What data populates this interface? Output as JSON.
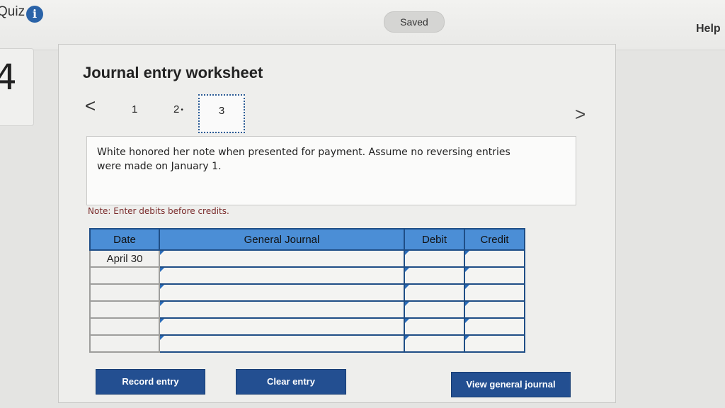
{
  "header": {
    "quiz_label": "Quiz",
    "info_icon": "i",
    "saved_label": "Saved",
    "help_label": "Help"
  },
  "sidebar": {
    "question_number": "4"
  },
  "worksheet": {
    "title": "Journal entry worksheet",
    "nav_prev": "<",
    "nav_next": ">",
    "tabs": [
      {
        "label": "1"
      },
      {
        "label": "2",
        "marker": "•"
      },
      {
        "label": "3",
        "active": true
      }
    ],
    "prompt": "White honored her note when presented for payment. Assume no reversing entries were made on January 1.",
    "note": "Note: Enter debits before credits."
  },
  "journal": {
    "headers": [
      "Date",
      "General Journal",
      "Debit",
      "Credit"
    ],
    "rows": [
      {
        "date": "April 30",
        "account": "",
        "debit": "",
        "credit": ""
      },
      {
        "date": "",
        "account": "",
        "debit": "",
        "credit": ""
      },
      {
        "date": "",
        "account": "",
        "debit": "",
        "credit": ""
      },
      {
        "date": "",
        "account": "",
        "debit": "",
        "credit": ""
      },
      {
        "date": "",
        "account": "",
        "debit": "",
        "credit": ""
      },
      {
        "date": "",
        "account": "",
        "debit": "",
        "credit": ""
      }
    ]
  },
  "buttons": {
    "record": "Record entry",
    "clear": "Clear entry",
    "view": "View general journal"
  },
  "colors": {
    "accent": "#234f91",
    "table_header": "#4b8ed6",
    "info_icon": "#2a63a8"
  }
}
